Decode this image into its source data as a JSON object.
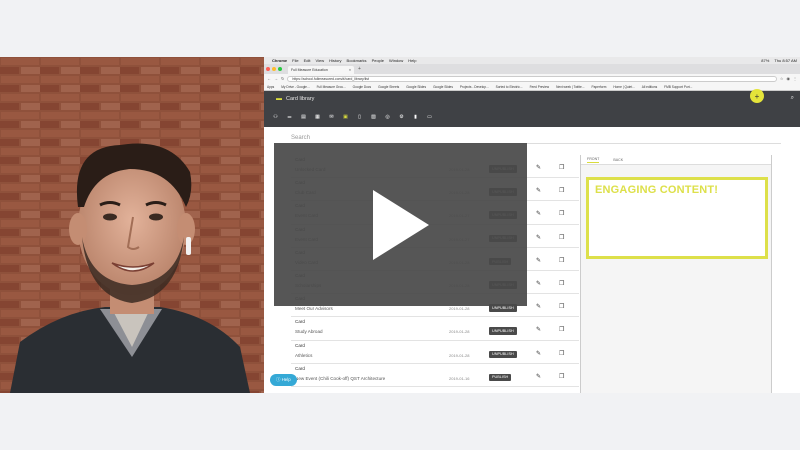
{
  "colors": {
    "accent": "#dde04a",
    "header": "#3f4145",
    "overlay": "#494949",
    "help_button": "#35a9d6"
  },
  "webcam": {
    "icon": "person-video-feed"
  },
  "mac_menu": {
    "items": [
      "Chrome",
      "File",
      "Edit",
      "View",
      "History",
      "Bookmarks",
      "People",
      "Window",
      "Help"
    ],
    "clock": "Thu 8:57 AM",
    "battery": "87%"
  },
  "browser": {
    "tab_title": "Full Measure Education",
    "tab_close": "×",
    "new_tab": "+",
    "url": "https://school.fullmeasured.com/#/card_library/list",
    "bookmarks": [
      "Apps",
      "My Drive - Google...",
      "Full Measure Grou...",
      "Google Docs",
      "Google Sheets",
      "Google Slides",
      "Google Slides",
      "Projects - Develop...",
      "Sorted to Electric...",
      "Feed Preview",
      "Next week | Twitte...",
      "Paperform",
      "Home | Quiet...",
      "All editions",
      "FMB Support Port..."
    ]
  },
  "app": {
    "title": "Card library",
    "search_placeholder": "Search",
    "fab_label": "+",
    "toolbar_icons": [
      "people-icon",
      "sliders-icon",
      "document-icon",
      "calendar-icon",
      "chat-icon",
      "library-icon",
      "tablet-icon",
      "image-icon",
      "target-icon",
      "settings-icon",
      "phone-icon",
      "video-icon"
    ]
  },
  "cards": [
    {
      "type": "Card",
      "date": "2019-01-28",
      "action": "UNPUBLISH",
      "label": "Unlocked Card"
    },
    {
      "type": "Card",
      "date": "2019-01-28",
      "action": "UNPUBLISH",
      "label": "Club Card"
    },
    {
      "type": "Card",
      "date": "2019-01-27",
      "action": "UNPUBLISH",
      "label": "Event Card"
    },
    {
      "type": "Card",
      "date": "2019-01-27",
      "action": "UNPUBLISH",
      "label": "Event Card"
    },
    {
      "type": "Card",
      "date": "2019-01-28",
      "action": "PUBLISH",
      "label": "Video Card"
    },
    {
      "type": "Card",
      "date": "2019-01-28",
      "action": "UNPUBLISH",
      "label": "Scholarships"
    },
    {
      "type": "Card",
      "date": "2019-01-28",
      "action": "UNPUBLISH",
      "label": "Meet Our Advisors"
    },
    {
      "type": "Card",
      "date": "2019-01-28",
      "action": "UNPUBLISH",
      "label": "Study Abroad"
    },
    {
      "type": "Card",
      "date": "2019-01-28",
      "action": "UNPUBLISH",
      "label": "Athletics"
    },
    {
      "type": "Card",
      "date": "2019-01-16",
      "action": "PUBLISH",
      "label": "New Event (Chili Cook-off) QST Architecture"
    }
  ],
  "preview": {
    "tab_front": "FRONT",
    "tab_back": "BACK",
    "heading": "ENGAGING CONTENT!"
  },
  "help_label": "Help",
  "video": {
    "control": "play-icon"
  }
}
